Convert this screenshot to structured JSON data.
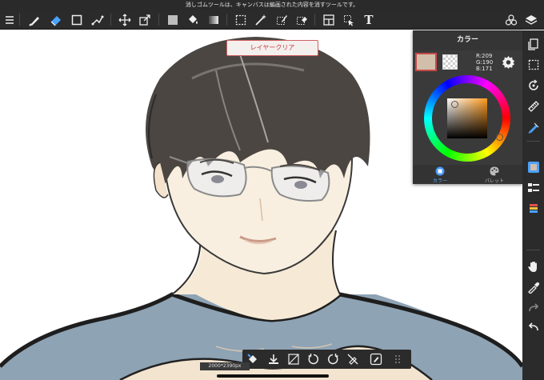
{
  "hint": {
    "text": "消しゴムツールは、キャンバスは編画された内容を消すツールです。"
  },
  "toolbar": {
    "items": [
      {
        "icon": "menu-icon"
      },
      {
        "icon": "brush-icon"
      },
      {
        "icon": "eraser-icon"
      },
      {
        "icon": "rectangle-icon"
      },
      {
        "icon": "pen-nodes-icon"
      },
      {
        "icon": "move-icon"
      },
      {
        "icon": "transform-icon"
      },
      {
        "icon": "fill-color-icon"
      },
      {
        "icon": "bucket-icon"
      },
      {
        "icon": "gradient-icon"
      },
      {
        "icon": "select-rect-icon"
      },
      {
        "icon": "magic-wand-icon"
      },
      {
        "icon": "select-pen-icon"
      },
      {
        "icon": "select-eraser-icon"
      },
      {
        "icon": "panel-layout-icon"
      },
      {
        "icon": "select-move-icon"
      },
      {
        "icon": "text-icon"
      }
    ],
    "right_items": [
      {
        "icon": "materials-icon"
      },
      {
        "icon": "layers-icon"
      }
    ],
    "text_glyph": "T"
  },
  "clear_button": {
    "label": "レイヤークリア"
  },
  "color_panel": {
    "title": "カラー",
    "main_color": "#d1beab",
    "rgb": {
      "r": "R:209",
      "g": "G:190",
      "b": "B:171"
    },
    "tabs": [
      {
        "label": "カラー",
        "icon": "color-circle-icon",
        "active": true
      },
      {
        "label": "パレット",
        "icon": "palette-icon",
        "active": false
      }
    ]
  },
  "right_bar": {
    "items": [
      {
        "icon": "pages-icon"
      },
      {
        "icon": "selection-icon"
      },
      {
        "icon": "rotate-icon"
      },
      {
        "icon": "ruler-icon"
      },
      {
        "icon": "snap-pen-icon"
      },
      {
        "icon": "color-panel-icon"
      },
      {
        "icon": "layers-list-icon"
      },
      {
        "icon": "brush-list-icon"
      },
      {
        "icon": "hand-icon"
      },
      {
        "icon": "eyedropper-icon"
      },
      {
        "icon": "redo-icon"
      },
      {
        "icon": "undo-icon"
      }
    ]
  },
  "bottom_bar": {
    "items": [
      {
        "icon": "bucket-swap-icon"
      },
      {
        "icon": "import-icon"
      },
      {
        "icon": "flip-icon"
      },
      {
        "icon": "rotate-left-icon"
      },
      {
        "icon": "rotate-right-icon"
      },
      {
        "icon": "no-snap-icon"
      },
      {
        "icon": "fill-edit-icon"
      },
      {
        "icon": "grip-icon"
      }
    ],
    "size_label": "2000*2390px"
  }
}
